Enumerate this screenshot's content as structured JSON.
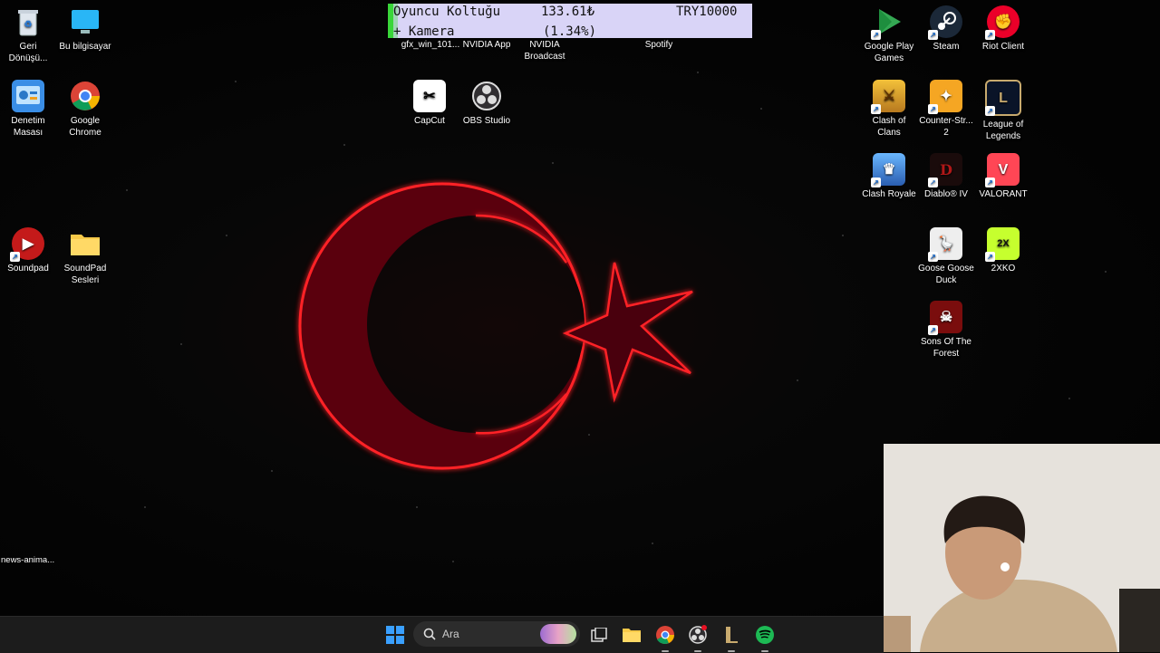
{
  "desktop_icons": {
    "recycle_bin": "Geri Dönüşü...",
    "this_pc": "Bu bilgisayar",
    "control_panel": "Denetim Masası",
    "chrome": "Google Chrome",
    "soundpad": "Soundpad",
    "soundpad_folder": "SoundPad Sesleri",
    "gfx": "gfx_win_101...",
    "nvidia_app": "NVIDIA App",
    "nvidia_broadcast": "NVIDIA Broadcast",
    "spotify": "Spotify",
    "capcut": "CapCut",
    "obs": "OBS Studio",
    "google_play_games": "Google Play Games",
    "steam": "Steam",
    "riot_client": "Riot Client",
    "clash_of_clans": "Clash of Clans",
    "counter_strike": "Counter-Str... 2",
    "league": "League of Legends",
    "clash_royale": "Clash Royale",
    "diablo": "Diablo® IV",
    "valorant": "VALORANT",
    "goose": "Goose Goose Duck",
    "twoxko": "2XKO",
    "sons_forest": "Sons Of The Forest",
    "news": "news-anima..."
  },
  "donation_widget": {
    "item": "Oyuncu Koltuğu",
    "current": "133.61₺",
    "goal": "TRY10000",
    "line2": "+ Kamera",
    "percent": "(1.34%)",
    "progress_fraction": 0.0134
  },
  "taskbar": {
    "search_placeholder": "Ara"
  },
  "colors": {
    "flag_red": "#e0141e",
    "progress_green": "#39d639",
    "widget_bg": "#d9d4f7",
    "taskbar_bg": "#1c1c1c"
  }
}
